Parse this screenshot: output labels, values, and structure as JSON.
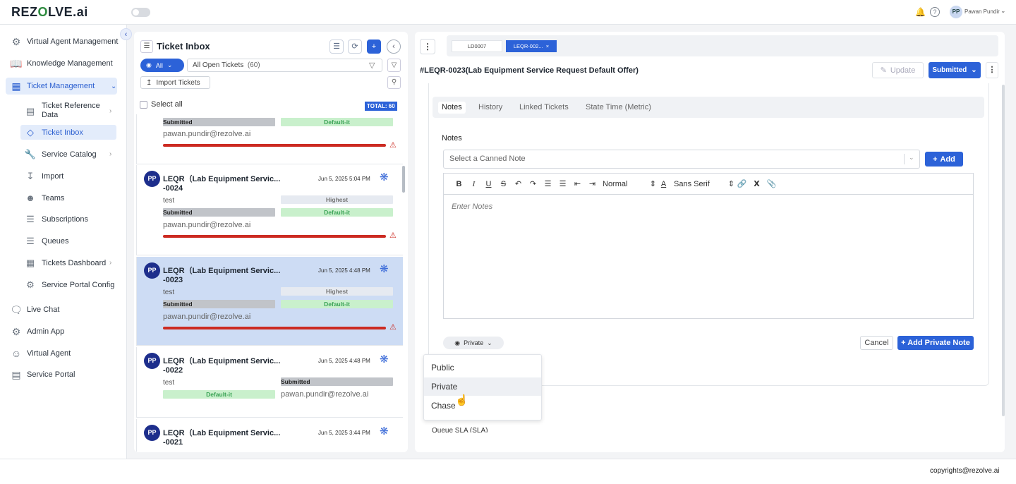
{
  "app": {
    "logo_pre": "REZ",
    "logo_o": "O",
    "logo_post": "LVE.ai",
    "user_initials": "PP",
    "user_name": "Pawan Pundir"
  },
  "sidebar": {
    "items": [
      {
        "label": "Virtual Agent Management",
        "icon": "users-gear-icon"
      },
      {
        "label": "Knowledge Management",
        "icon": "book-icon"
      },
      {
        "label": "Ticket Management",
        "icon": "ticket-screen-icon"
      },
      {
        "label": "Live Chat",
        "icon": "chat-icon"
      },
      {
        "label": "Admin App",
        "icon": "sliders-icon"
      },
      {
        "label": "Virtual Agent",
        "icon": "agent-icon"
      },
      {
        "label": "Service Portal",
        "icon": "portal-icon"
      }
    ],
    "sub_items": [
      {
        "label1": "Ticket Reference",
        "label2": "Data"
      },
      {
        "label": "Ticket Inbox"
      },
      {
        "label": "Service Catalog"
      },
      {
        "label": "Import"
      },
      {
        "label": "Teams"
      },
      {
        "label": "Subscriptions"
      },
      {
        "label": "Queues"
      },
      {
        "label": "Tickets Dashboard"
      },
      {
        "label": "Service Portal Config"
      }
    ]
  },
  "inbox": {
    "title": "Ticket Inbox",
    "filter_all": "All",
    "filter_label": "All Open Tickets",
    "filter_count": "(60)",
    "import_label": "Import Tickets",
    "select_all": "Select all",
    "total": "TOTAL: 60",
    "tickets": [
      {
        "status": "Submitted",
        "group": "Default-it",
        "email": "pawan.pundir@rezolve.ai"
      },
      {
        "initials": "PP",
        "title1": "LEQR（Lab Equipment Servic...",
        "title2": "-0024",
        "date": "Jun 5, 2025 5:04 PM",
        "desc": "test",
        "priority": "Highest",
        "status": "Submitted",
        "group": "Default-it",
        "email": "pawan.pundir@rezolve.ai"
      },
      {
        "initials": "PP",
        "title1": "LEQR（Lab Equipment Servic...",
        "title2": "-0023",
        "date": "Jun 5, 2025 4:48 PM",
        "desc": "test",
        "priority": "Highest",
        "status": "Submitted",
        "group": "Default-it",
        "email": "pawan.pundir@rezolve.ai"
      },
      {
        "initials": "PP",
        "title1": "LEQR（Lab Equipment Servic...",
        "title2": "-0022",
        "date": "Jun 5, 2025 4:48 PM",
        "desc": "test",
        "status": "Submitted",
        "group": "Default-it",
        "email": "pawan.pundir@rezolve.ai"
      },
      {
        "initials": "PP",
        "title1": "LEQR（Lab Equipment Servic...",
        "title2": "-0021",
        "date": "Jun 5, 2025 3:44 PM"
      }
    ]
  },
  "detail": {
    "tabs": [
      "LD0007",
      "LEQR-002..."
    ],
    "title": "#LEQR-0023(Lab Equipment Service Request Default Offer)",
    "update": "Update",
    "status": "Submitted",
    "subtabs": [
      "Notes",
      "History",
      "Linked Tickets",
      "State Time (Metric)"
    ],
    "notes_label": "Notes",
    "canned_placeholder": "Select a Canned Note",
    "add": "Add",
    "format": "Normal",
    "font": "Sans Serif",
    "editor_placeholder": "Enter Notes",
    "privacy": "Private",
    "cancel": "Cancel",
    "add_private": "+ Add Private Note",
    "privacy_options": [
      "Public",
      "Private",
      "Chase"
    ],
    "queue_sla": "Queue SLA (SLA)"
  },
  "footer": {
    "copyright": "copyrights@rezolve.ai"
  }
}
